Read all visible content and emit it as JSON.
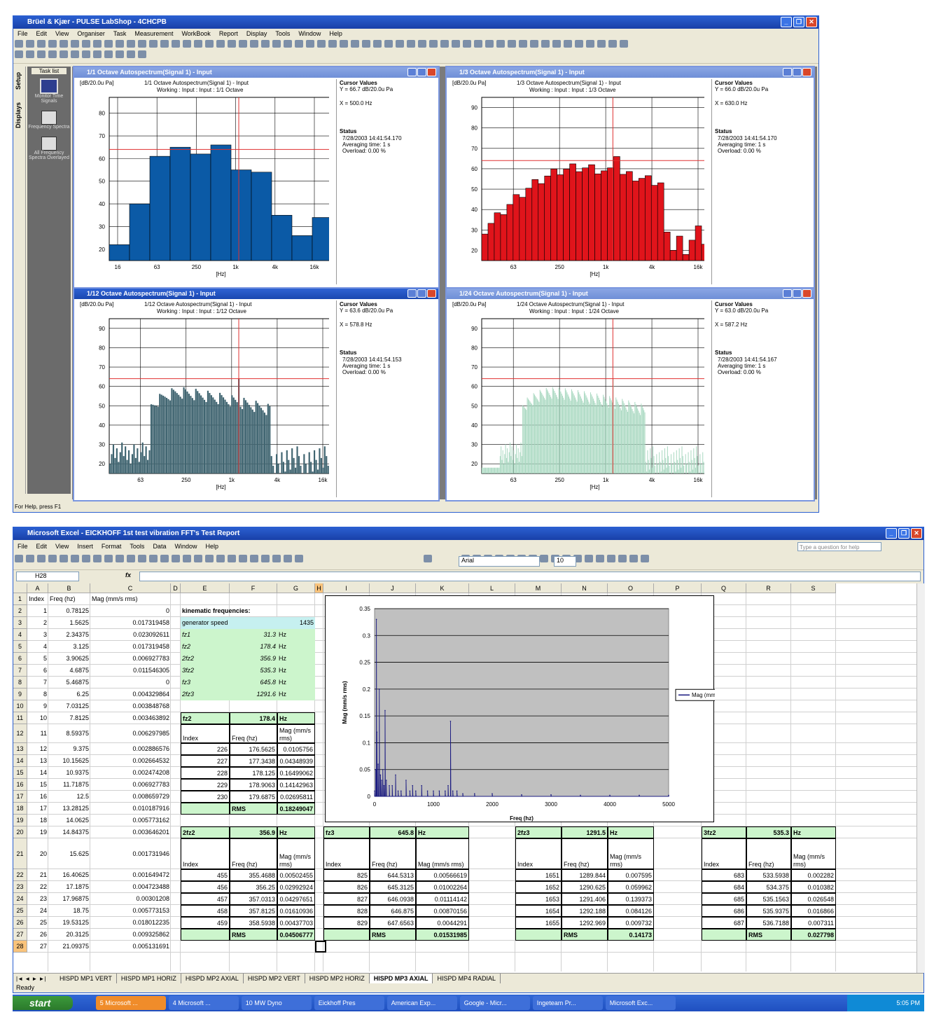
{
  "pulse": {
    "title": "Brüel & Kjær - PULSE LabShop - 4CHCPB",
    "menu": [
      "File",
      "Edit",
      "View",
      "Organiser",
      "Task",
      "Measurement",
      "WorkBook",
      "Report",
      "Display",
      "Tools",
      "Window",
      "Help"
    ],
    "side_tabs": [
      "Setup",
      "Displays"
    ],
    "task_list_label": "Task list",
    "task_items": [
      "Monitor Time Signals",
      "Frequency Spectra",
      "All Frequency Spectra Overlayed"
    ],
    "status_text": "For Help, press F1",
    "panels": [
      {
        "title": "1/1 Octave Autospectrum(Signal 1) - Input",
        "unit": "[dB/20.0u Pa]",
        "head1": "1/1 Octave Autospectrum(Signal 1) - Input",
        "head2": "Working : Input : Input : 1/1 Octave",
        "cursor_title": "Cursor Values",
        "cursor_y": "Y = 66.7 dB/20.0u Pa",
        "cursor_x": "X = 500.0 Hz",
        "status_title": "Status",
        "status_date": "7/28/2003  14:41:54.170",
        "status_avg": "Averaging time:       1 s",
        "status_ovl": "Overload:   0.00 %",
        "color": "#0b5aa6"
      },
      {
        "title": "1/3 Octave Autospectrum(Signal 1) - Input",
        "unit": "[dB/20.0u Pa]",
        "head1": "1/3 Octave Autospectrum(Signal 1) - Input",
        "head2": "Working : Input : Input : 1/3 Octave",
        "cursor_title": "Cursor Values",
        "cursor_y": "Y = 66.0 dB/20.0u Pa",
        "cursor_x": "X = 630.0 Hz",
        "status_title": "Status",
        "status_date": "7/28/2003  14:41:54.170",
        "status_avg": "Averaging time:       1 s",
        "status_ovl": "Overload:   0.00 %",
        "color": "#e0141b"
      },
      {
        "title": "1/12 Octave Autospectrum(Signal 1) - Input",
        "unit": "[dB/20.0u Pa]",
        "head1": "1/12 Octave Autospectrum(Signal 1) - Input",
        "head2": "Working : Input : Input : 1/12 Octave",
        "cursor_title": "Cursor Values",
        "cursor_y": "Y = 63.6 dB/20.0u Pa",
        "cursor_x": "X = 578.8 Hz",
        "status_title": "Status",
        "status_date": "7/28/2003  14:41:54.153",
        "status_avg": "Averaging time:       1 s",
        "status_ovl": "Overload:   0.00 %",
        "color": "#3f6470"
      },
      {
        "title": "1/24 Octave Autospectrum(Signal 1) - Input",
        "unit": "[dB/20.0u Pa]",
        "head1": "1/24 Octave Autospectrum(Signal 1) - Input",
        "head2": "Working : Input : Input : 1/24 Octave",
        "cursor_title": "Cursor Values",
        "cursor_y": "Y = 63.0 dB/20.0u Pa",
        "cursor_x": "X = 587.2 Hz",
        "status_title": "Status",
        "status_date": "7/28/2003  14:41:54.167",
        "status_avg": "Averaging time:       1 s",
        "status_ovl": "Overload:   0.00 %",
        "color": "#a8d8c0"
      }
    ],
    "xaxis_unit": "[Hz]",
    "x_ticks_a": [
      "16",
      "63",
      "250",
      "1k",
      "4k",
      "16k"
    ],
    "x_ticks_b": [
      "63",
      "250",
      "1k",
      "4k",
      "16k"
    ],
    "y_ticks_a": [
      "20",
      "30",
      "40",
      "50",
      "60",
      "70",
      "80"
    ],
    "y_ticks_b": [
      "20",
      "30",
      "40",
      "50",
      "60",
      "70",
      "80",
      "90"
    ]
  },
  "excel": {
    "title": "Microsoft Excel - EICKHOFF 1st test vibration FFT's Test Report",
    "menu": [
      "File",
      "Edit",
      "View",
      "Insert",
      "Format",
      "Tools",
      "Data",
      "Window",
      "Help"
    ],
    "help_placeholder": "Type a question for help",
    "font_name": "Arial",
    "font_size": "10",
    "name_box": "H28",
    "fx": "fx",
    "columns": [
      "A",
      "B",
      "C",
      "D",
      "E",
      "F",
      "G",
      "H",
      "I",
      "J",
      "K",
      "L",
      "M",
      "N",
      "O",
      "P",
      "Q",
      "R",
      "S"
    ],
    "rows": [
      "1",
      "2",
      "3",
      "4",
      "5",
      "6",
      "7",
      "8",
      "9",
      "10",
      "11",
      "12",
      "13",
      "14",
      "15",
      "16",
      "17",
      "18",
      "19",
      "20",
      "21",
      "22",
      "23",
      "24",
      "25",
      "26",
      "27",
      "28"
    ],
    "headers": [
      "Index",
      "Freq (hz)",
      "Mag (mm/s rms)"
    ],
    "colA": [
      "",
      "1",
      "2",
      "3",
      "4",
      "5",
      "6",
      "7",
      "8",
      "9",
      "10",
      "11",
      "12",
      "13",
      "14",
      "15",
      "16",
      "17",
      "18",
      "19",
      "20",
      "21",
      "22",
      "23",
      "24",
      "25",
      "26",
      "27"
    ],
    "colB": [
      "",
      "0.78125",
      "1.5625",
      "2.34375",
      "3.125",
      "3.90625",
      "4.6875",
      "5.46875",
      "6.25",
      "7.03125",
      "7.8125",
      "8.59375",
      "9.375",
      "10.15625",
      "10.9375",
      "11.71875",
      "12.5",
      "13.28125",
      "14.0625",
      "14.84375",
      "15.625",
      "16.40625",
      "17.1875",
      "17.96875",
      "18.75",
      "19.53125",
      "20.3125",
      "21.09375"
    ],
    "colC": [
      "",
      "0",
      "0.017319458",
      "0.023092611",
      "0.017319458",
      "0.006927783",
      "0.011546305",
      "0",
      "0.004329864",
      "0.003848768",
      "0.003463892",
      "0.006297985",
      "0.002886576",
      "0.002664532",
      "0.002474208",
      "0.006927783",
      "0.008659729",
      "0.010187916",
      "0.005773162",
      "0.003646201",
      "0.001731946",
      "0.001649472",
      "0.004723488",
      "0.00301208",
      "0.005773153",
      "0.018012235",
      "0.009325862",
      "0.005131691"
    ],
    "kin_title": "kinematic frequencies:",
    "kin_rows": [
      [
        "generator speed",
        "",
        "1435"
      ],
      [
        "fz1",
        "31.3",
        "Hz"
      ],
      [
        "fz2",
        "178.4",
        "Hz"
      ],
      [
        "2fz2",
        "356.9",
        "Hz"
      ],
      [
        "3fz2",
        "535.3",
        "Hz"
      ],
      [
        "fz3",
        "645.8",
        "Hz"
      ],
      [
        "2fz3",
        "1291.6",
        "Hz"
      ]
    ],
    "blocks": [
      {
        "name": "fz2",
        "val": "178.4",
        "unit": "Hz",
        "h": [
          "Index",
          "Freq (hz)",
          "Mag (mm/s rms)"
        ],
        "rows": [
          [
            "226",
            "176.5625",
            "0.0105756"
          ],
          [
            "227",
            "177.3438",
            "0.04348939"
          ],
          [
            "228",
            "178.125",
            "0.16499062"
          ],
          [
            "229",
            "178.9063",
            "0.14142963"
          ],
          [
            "230",
            "179.6875",
            "0.02695811"
          ]
        ],
        "rms_label": "RMS",
        "rms": "0.18249047"
      },
      {
        "name": "2fz2",
        "val": "356.9",
        "unit": "Hz",
        "h": [
          "Index",
          "Freq (hz)",
          "Mag (mm/s rms)"
        ],
        "rows": [
          [
            "455",
            "355.4688",
            "0.00502455"
          ],
          [
            "456",
            "356.25",
            "0.02992924"
          ],
          [
            "457",
            "357.0313",
            "0.04297651"
          ],
          [
            "458",
            "357.8125",
            "0.01610936"
          ],
          [
            "459",
            "358.5938",
            "0.00437703"
          ]
        ],
        "rms_label": "RMS",
        "rms": "0.04506777"
      },
      {
        "name": "fz3",
        "val": "645.8",
        "unit": "Hz",
        "h": [
          "Index",
          "Freq (hz)",
          "Mag (mm/s rms)"
        ],
        "rows": [
          [
            "825",
            "644.5313",
            "0.00566619"
          ],
          [
            "826",
            "645.3125",
            "0.01002264"
          ],
          [
            "827",
            "646.0938",
            "0.01114142"
          ],
          [
            "828",
            "646.875",
            "0.00870156"
          ],
          [
            "829",
            "647.6563",
            "0.0044291"
          ]
        ],
        "rms_label": "RMS",
        "rms": "0.01531985"
      },
      {
        "name": "2fz3",
        "val": "1291.5",
        "unit": "Hz",
        "h": [
          "Index",
          "Freq (hz)",
          "Mag (mm/s rms)"
        ],
        "rows": [
          [
            "1651",
            "1289.844",
            "0.007595"
          ],
          [
            "1652",
            "1290.625",
            "0.059962"
          ],
          [
            "1653",
            "1291.406",
            "0.139373"
          ],
          [
            "1654",
            "1292.188",
            "0.084126"
          ],
          [
            "1655",
            "1292.969",
            "0.009732"
          ]
        ],
        "rms_label": "RMS",
        "rms": "0.14173"
      },
      {
        "name": "3fz2",
        "val": "535.3",
        "unit": "Hz",
        "h": [
          "Index",
          "Freq (hz)",
          "Mag (mm/s rms)"
        ],
        "rows": [
          [
            "683",
            "533.5938",
            "0.002282"
          ],
          [
            "684",
            "534.375",
            "0.010382"
          ],
          [
            "685",
            "535.1563",
            "0.026548"
          ],
          [
            "686",
            "535.9375",
            "0.016866"
          ],
          [
            "687",
            "536.7188",
            "0.007311"
          ]
        ],
        "rms_label": "RMS",
        "rms": "0.027798"
      }
    ],
    "sheet_tabs": [
      "HISPD MP1 VERT",
      "HISPD MP1 HORIZ",
      "HISPD MP2 AXIAL",
      "HISPD MP2 VERT",
      "HISPD MP2 HORIZ",
      "HISPD MP3 AXIAL",
      "HISPD MP4 RADIAL"
    ],
    "active_tab": "HISPD MP3 AXIAL",
    "status": "Ready"
  },
  "chart_data": {
    "type": "line",
    "title": "",
    "xlabel": "Freq (hz)",
    "ylabel": "Mag (mm/s rms)",
    "xlim": [
      0,
      5000
    ],
    "ylim": [
      0,
      0.35
    ],
    "x_ticks": [
      "0",
      "1000",
      "2000",
      "3000",
      "4000",
      "5000"
    ],
    "y_ticks": [
      "0",
      "0.05",
      "0.1",
      "0.15",
      "0.2",
      "0.25",
      "0.3",
      "0.35"
    ],
    "series": [
      {
        "name": "Mag (mm/s rms)",
        "x": [
          0,
          20,
          31,
          40,
          60,
          80,
          100,
          120,
          140,
          160,
          178,
          200,
          250,
          300,
          357,
          400,
          450,
          535,
          600,
          646,
          700,
          800,
          900,
          1000,
          1100,
          1200,
          1250,
          1291,
          1330,
          1400,
          1500,
          1700,
          2000,
          2500,
          3000,
          3500,
          4000,
          4500,
          5000
        ],
        "values": [
          0.01,
          0.05,
          0.33,
          0.12,
          0.06,
          0.2,
          0.04,
          0.03,
          0.05,
          0.02,
          0.16,
          0.03,
          0.02,
          0.02,
          0.04,
          0.01,
          0.01,
          0.03,
          0.01,
          0.02,
          0.01,
          0.02,
          0.01,
          0.01,
          0.01,
          0.01,
          0.02,
          0.14,
          0.01,
          0.01,
          0.005,
          0.005,
          0.005,
          0.003,
          0.003,
          0.002,
          0.002,
          0.002,
          0.002
        ]
      }
    ],
    "legend": "right",
    "plot_bg": "#c0c0c0"
  },
  "taskbar": {
    "start": "start",
    "items": [
      "5 Microsoft ...",
      "4 Microsoft ...",
      "10 MW Dyno",
      "Eickhoff Pres",
      "American Exp...",
      "Google - Micr...",
      "Ingeteam Pr...",
      "Microsoft Exc..."
    ],
    "clock": "5:05 PM"
  }
}
